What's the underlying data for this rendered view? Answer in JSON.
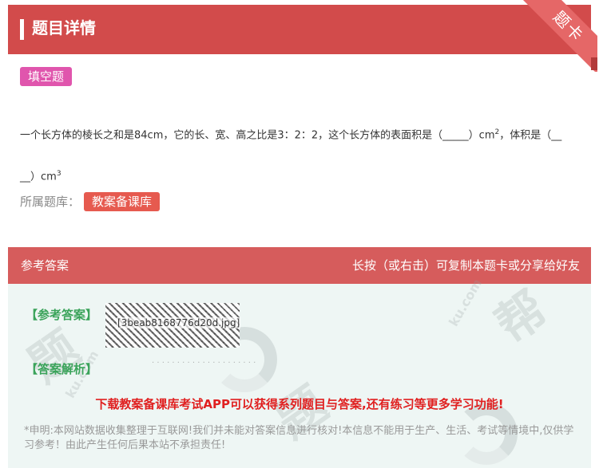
{
  "header": {
    "title": "题目详情",
    "corner_badge": "题卡"
  },
  "question": {
    "type_tag": "填空题",
    "text_part1": "一个长方体的棱长之和是84cm，它的长、宽、高之比是3：2：2，这个长方体的表面积是（_____）cm",
    "sup1": "2",
    "text_part2": "，体积是（__",
    "text_part3": "__）cm",
    "sup2": "3"
  },
  "bank": {
    "label": "所属题库：",
    "name": "教案备课库"
  },
  "answer_section": {
    "title": "参考答案",
    "hint": "长按（或右击）可复制本题卡或分享给好友",
    "answer_label": "【参考答案】",
    "answer_image_caption": "[3beab8168776d20d.jpg]",
    "explanation_label": "【答案解析】",
    "promo": "下载教案备课库考试APP可以获得系列题目与答案,还有练习等更多学习功能!",
    "disclaimer": "*申明:本网站数据收集整理于互联网!我们并未能对答案信息进行核对!本信息不能用于生产、生活、考试等情境中,仅供学习参考！由此产生任何后果本站不承担责任!"
  },
  "colors": {
    "header_red": "#d24b4b",
    "tag_pink": "#e055ad",
    "bank_red": "#e65a4f",
    "answer_green": "#3aa35a",
    "promo_red": "#e02020"
  }
}
